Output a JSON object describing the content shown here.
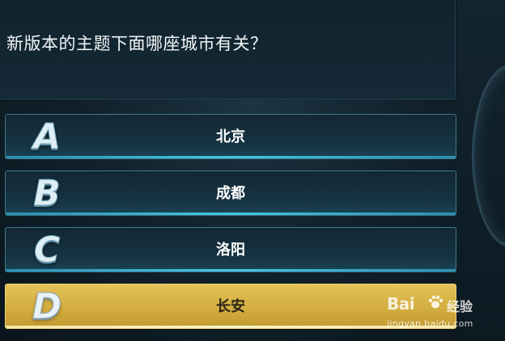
{
  "question": {
    "text": "新版本的主题下面哪座城市有关？"
  },
  "options": [
    {
      "letter": "A",
      "text": "北京",
      "selected": false
    },
    {
      "letter": "B",
      "text": "成都",
      "selected": false
    },
    {
      "letter": "C",
      "text": "洛阳",
      "selected": false
    },
    {
      "letter": "D",
      "text": "长安",
      "selected": true
    }
  ],
  "watermark": {
    "brand": "Bai",
    "suffix": "经验",
    "domain": "jingyan.baidu.com",
    "icon": "paw-icon"
  },
  "colors": {
    "option_border": "#3d7b8c",
    "option_bottom_glow": "#47c6e3",
    "selected_fill": "#d3ad3e"
  }
}
